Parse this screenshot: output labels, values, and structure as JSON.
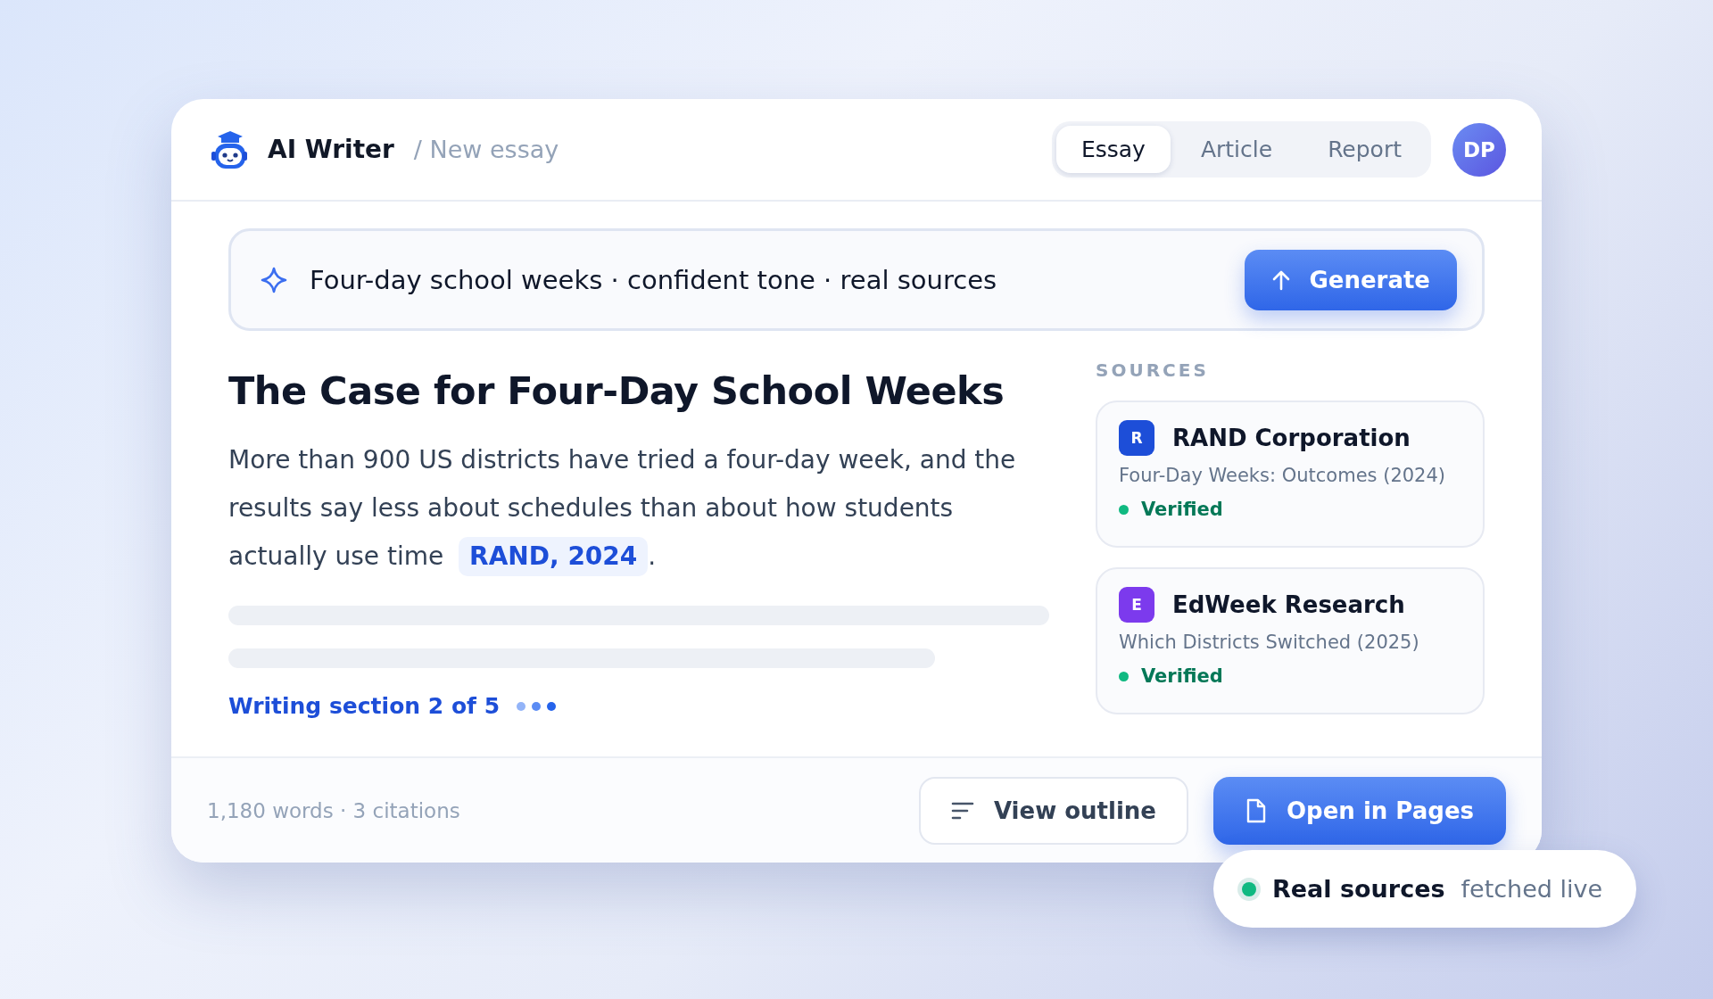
{
  "header": {
    "app_name": "AI Writer",
    "breadcrumb": "/ New essay",
    "tabs": [
      {
        "label": "Essay",
        "selected": true
      },
      {
        "label": "Article",
        "selected": false
      },
      {
        "label": "Report",
        "selected": false
      }
    ],
    "avatar": "DP"
  },
  "prompt": {
    "value": "Four-day school weeks · confident tone · real sources",
    "button": "Generate"
  },
  "essay": {
    "title": "The Case for Four-Day School Weeks",
    "paragraph": "More than 900 US districts have tried a four-day week, and the results say less about schedules than about how students actually use time",
    "citation": "RAND, 2024",
    "after_citation": ".",
    "status": "Writing section 2 of 5"
  },
  "sources": {
    "heading": "SOURCES",
    "items": [
      {
        "letter": "R",
        "color": "#1d4ed8",
        "name": "RAND Corporation",
        "detail": "Four-Day Weeks: Outcomes (2024)",
        "status": "Verified"
      },
      {
        "letter": "E",
        "color": "#7c3aed",
        "name": "EdWeek Research",
        "detail": "Which Districts Switched (2025)",
        "status": "Verified"
      }
    ]
  },
  "footer": {
    "stats": "1,180 words · 3 citations",
    "buttons": [
      {
        "label": "View outline",
        "kind": "secondary"
      },
      {
        "label": "Open in Pages",
        "kind": "primary"
      }
    ]
  },
  "badge": {
    "strong": "Real sources",
    "light": "fetched live"
  }
}
